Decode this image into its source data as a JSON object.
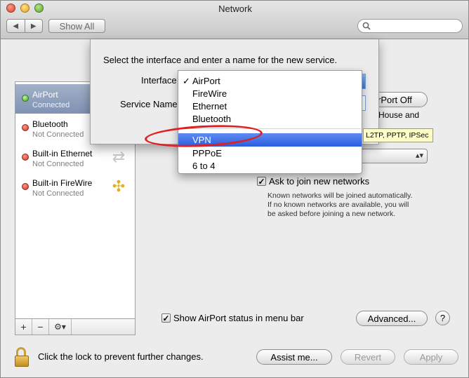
{
  "window": {
    "title": "Network"
  },
  "toolbar": {
    "back_icon": "back-arrow-icon",
    "forward_icon": "forward-arrow-icon",
    "show_all_label": "Show All",
    "search_icon": "search-icon",
    "search_placeholder": ""
  },
  "sidebar": {
    "services": [
      {
        "name": "AirPort",
        "status": "Connected",
        "state": "green",
        "selected": true
      },
      {
        "name": "Bluetooth",
        "status": "Not Connected",
        "state": "red",
        "selected": false
      },
      {
        "name": "Built-in Ethernet",
        "status": "Not Connected",
        "state": "red",
        "selected": false
      },
      {
        "name": "Built-in FireWire",
        "status": "Not Connected",
        "state": "red",
        "selected": false
      }
    ],
    "add_label": "+",
    "remove_label": "−",
    "action_label": "⚙▾"
  },
  "sheet": {
    "instruction": "Select the interface and enter a name for the new service.",
    "interface_label": "Interface",
    "service_name_label": "Service Name"
  },
  "interface_menu": {
    "checked_mark": "✓",
    "items_group1": [
      "AirPort",
      "FireWire",
      "Ethernet",
      "Bluetooth"
    ],
    "items_group2": [
      "VPN",
      "PPPoE",
      "6 to 4"
    ],
    "highlighted": "VPN"
  },
  "tooltip": {
    "text": "L2TP, PPTP, IPSec"
  },
  "pane": {
    "airport_off_label": "rPort Off",
    "partial_text": "House and",
    "ask_join_label": "Ask to join new networks",
    "ask_join_checked": true,
    "ask_join_desc": [
      "Known networks will be joined automatically.",
      "If no known networks are available, you will",
      "be asked before joining a new network."
    ],
    "show_status_label": "Show AirPort status in menu bar",
    "show_status_checked": true,
    "advanced_label": "Advanced...",
    "help_label": "?"
  },
  "footer": {
    "lock_text": "Click the lock to prevent further changes.",
    "assist_label": "Assist me...",
    "revert_label": "Revert",
    "apply_label": "Apply"
  },
  "colors": {
    "selection": "#7f92b3",
    "menu_highlight": "#2a5ee0",
    "annotation": "#e02020"
  }
}
